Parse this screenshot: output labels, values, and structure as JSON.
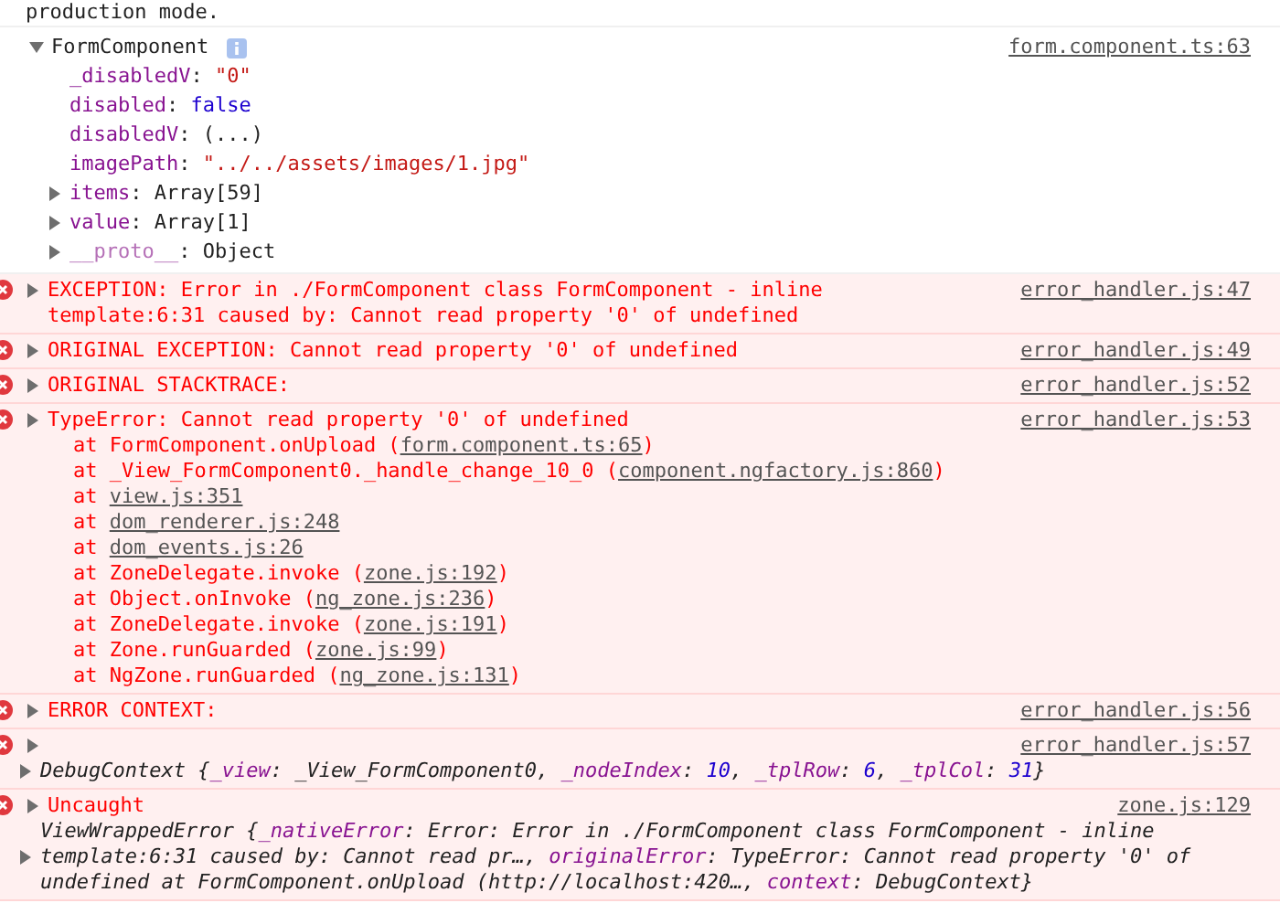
{
  "top_message": "production mode.",
  "object_log": {
    "label": "FormComponent",
    "expanded": true,
    "source": "form.component.ts:63",
    "properties": [
      {
        "key": "_disabledV",
        "separator": ": ",
        "value": "\"0\"",
        "kind": "string",
        "expandable": false,
        "dimmed": false
      },
      {
        "key": "disabled",
        "separator": ": ",
        "value": "false",
        "kind": "boolean",
        "expandable": false,
        "dimmed": false
      },
      {
        "key": "disabledV",
        "separator": ": ",
        "value": "(...)",
        "kind": "plain",
        "expandable": false,
        "dimmed": false
      },
      {
        "key": "imagePath",
        "separator": ": ",
        "value": "\"../../assets/images/1.jpg\"",
        "kind": "string",
        "expandable": false,
        "dimmed": false
      },
      {
        "key": "items",
        "separator": ": ",
        "value": "Array[59]",
        "kind": "plain",
        "expandable": true,
        "dimmed": false
      },
      {
        "key": "value",
        "separator": ": ",
        "value": "Array[1]",
        "kind": "plain",
        "expandable": true,
        "dimmed": false
      },
      {
        "key": "__proto__",
        "separator": ": ",
        "value": "Object",
        "kind": "plain",
        "expandable": true,
        "dimmed": true
      }
    ]
  },
  "errors": [
    {
      "message": "EXCEPTION: Error in ./FormComponent class FormComponent - inline template:6:31 caused by: Cannot read property '0' of undefined",
      "expanded": false,
      "source": "error_handler.js:47"
    },
    {
      "message": "ORIGINAL EXCEPTION: Cannot read property '0' of undefined",
      "expanded": false,
      "source": "error_handler.js:49"
    },
    {
      "message": "ORIGINAL STACKTRACE:",
      "expanded": false,
      "source": "error_handler.js:52"
    },
    {
      "message": "TypeError: Cannot read property '0' of undefined",
      "expanded": false,
      "source": "error_handler.js:53",
      "frames": [
        {
          "prefix": "at FormComponent.onUpload (",
          "link": "form.component.ts:65",
          "suffix": ")"
        },
        {
          "prefix": "at _View_FormComponent0._handle_change_10_0 (",
          "link": "component.ngfactory.js:860",
          "suffix": ")"
        },
        {
          "prefix": "at ",
          "link": "view.js:351"
        },
        {
          "prefix": "at ",
          "link": "dom_renderer.js:248"
        },
        {
          "prefix": "at ",
          "link": "dom_events.js:26"
        },
        {
          "prefix": "at ZoneDelegate.invoke (",
          "link": "zone.js:192",
          "suffix": ")"
        },
        {
          "prefix": "at Object.onInvoke (",
          "link": "ng_zone.js:236",
          "suffix": ")"
        },
        {
          "prefix": "at ZoneDelegate.invoke (",
          "link": "zone.js:191",
          "suffix": ")"
        },
        {
          "prefix": "at Zone.runGuarded (",
          "link": "zone.js:99",
          "suffix": ")"
        },
        {
          "prefix": "at NgZone.runGuarded (",
          "link": "ng_zone.js:131",
          "suffix": ")"
        }
      ]
    },
    {
      "message": "ERROR CONTEXT:",
      "expanded": false,
      "source": "error_handler.js:56"
    },
    {
      "expanded": false,
      "source": "error_handler.js:57",
      "detail": {
        "expanded": false,
        "parts": [
          {
            "text": "DebugContext {",
            "kind": "plain"
          },
          {
            "text": "_view",
            "kind": "key"
          },
          {
            "text": ": _View_FormComponent0, ",
            "kind": "plain"
          },
          {
            "text": "_nodeIndex",
            "kind": "key"
          },
          {
            "text": ": ",
            "kind": "plain"
          },
          {
            "text": "10",
            "kind": "number"
          },
          {
            "text": ", ",
            "kind": "plain"
          },
          {
            "text": "_tplRow",
            "kind": "key"
          },
          {
            "text": ": ",
            "kind": "plain"
          },
          {
            "text": "6",
            "kind": "number"
          },
          {
            "text": ", ",
            "kind": "plain"
          },
          {
            "text": "_tplCol",
            "kind": "key"
          },
          {
            "text": ": ",
            "kind": "plain"
          },
          {
            "text": "31",
            "kind": "number"
          },
          {
            "text": "}",
            "kind": "plain"
          }
        ]
      }
    },
    {
      "message": "Uncaught",
      "expanded": false,
      "source": "zone.js:129",
      "detail": {
        "expanded": false,
        "parts": [
          {
            "text": "ViewWrappedError {",
            "kind": "plain"
          },
          {
            "text": "_nativeError",
            "kind": "key"
          },
          {
            "text": ": Error: Error in ./FormComponent class FormComponent - inline template:6:31 caused by: Cannot read pr…, ",
            "kind": "plain"
          },
          {
            "text": "originalError",
            "kind": "key"
          },
          {
            "text": ": TypeError: Cannot read property '0' of undefined at FormComponent.onUpload (http://localhost:420…, ",
            "kind": "plain"
          },
          {
            "text": "context",
            "kind": "key"
          },
          {
            "text": ": DebugContext}",
            "kind": "plain"
          }
        ]
      }
    }
  ]
}
